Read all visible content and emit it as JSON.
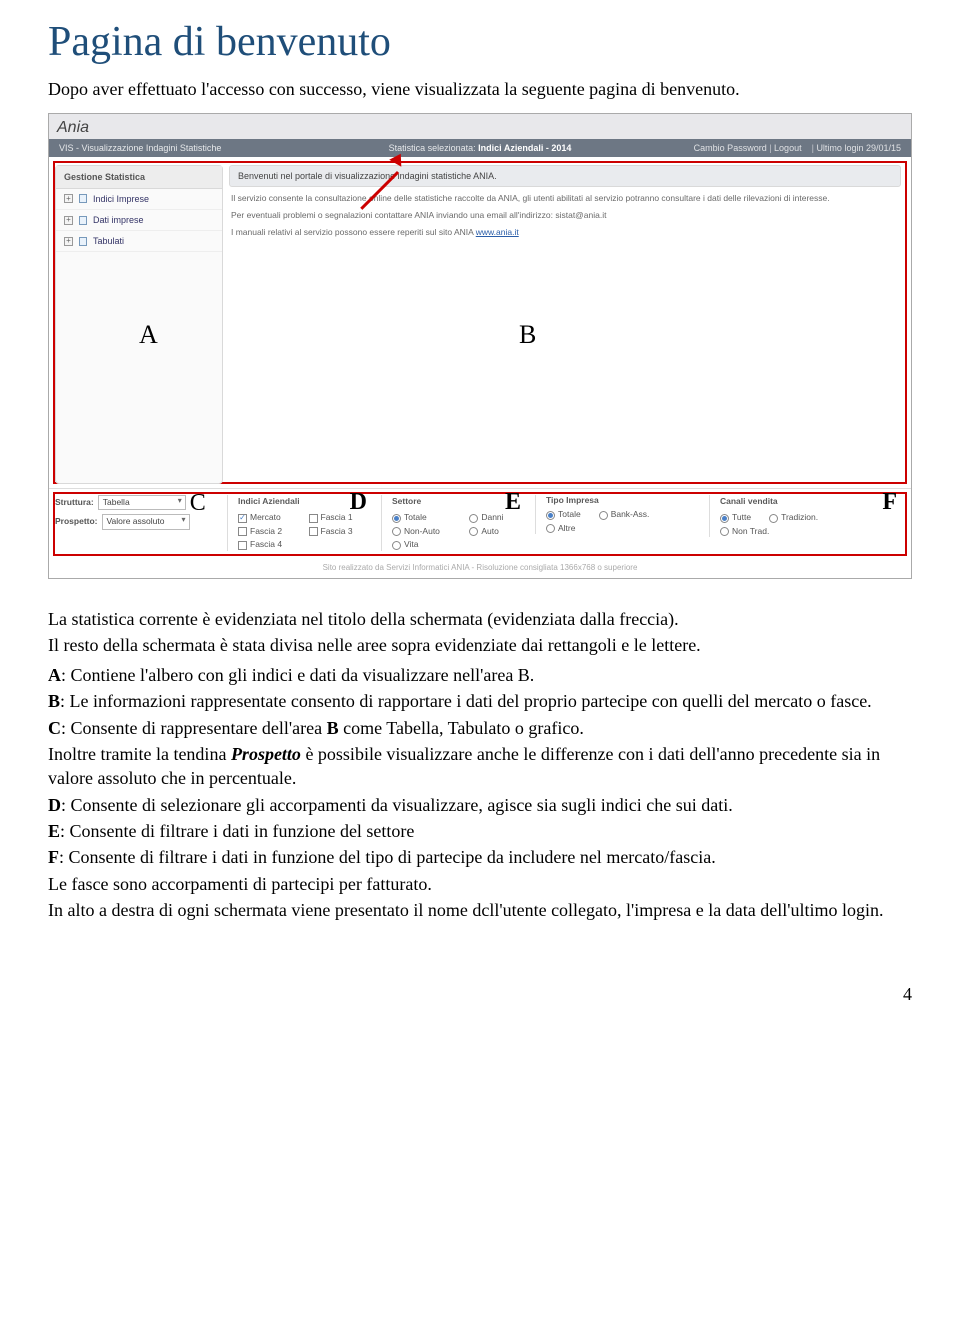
{
  "page": {
    "title": "Pagina di benvenuto",
    "intro": "Dopo aver effettuato l'accesso con successo, viene visualizzata la seguente pagina di benvenuto.",
    "number": "4"
  },
  "labels": {
    "A": "A",
    "B": "B",
    "C": "C",
    "D": "D",
    "E": "E",
    "F": "F"
  },
  "screenshot": {
    "brand": "Ania",
    "subtitle": "VIS - Visualizzazione Indagini Statistiche",
    "centerPrefix": "Statistica selezionata: ",
    "centerBold": "Indici Aziendali - 2014",
    "lastLogin": "Ultimo login 29/01/15",
    "rightLinks": {
      "a": "Cambio Password",
      "b": "Logout"
    },
    "sidebar": {
      "title": "Gestione Statistica",
      "items": [
        "Indici Imprese",
        "Dati imprese",
        "Tabulati"
      ]
    },
    "main": {
      "welcome": "Benvenuti nel portale di visualizzazione indagini statistiche ANIA.",
      "p1": "Il servizio consente la consultazione online delle statistiche raccolte da ANIA, gli utenti abilitati al servizio potranno consultare i dati delle rilevazioni di interesse.",
      "p2a": "Per eventuali problemi o segnalazioni contattare ANIA inviando una email all'indirizzo: ",
      "p2mail": "sistat@ania.it",
      "p3a": "I manuali relativi al servizio possono essere reperiti sul sito ANIA ",
      "p3link": "www.ania.it"
    },
    "bottom": {
      "struttura": {
        "label": "Struttura:",
        "value": "Tabella"
      },
      "prospetto": {
        "label": "Prospetto:",
        "value": "Valore assoluto"
      },
      "indici": {
        "title": "Indici Aziendali",
        "opts": [
          "Mercato",
          "Fascia 1",
          "Fascia 2",
          "Fascia 3",
          "Fascia 4"
        ]
      },
      "settore": {
        "title": "Settore",
        "opts": [
          "Totale",
          "Danni",
          "Non-Auto",
          "Auto",
          "Vita"
        ]
      },
      "tipo": {
        "title": "Tipo Impresa",
        "opts": [
          "Totale",
          "Bank-Ass.",
          "Altre"
        ]
      },
      "canali": {
        "title": "Canali vendita",
        "opts": [
          "Tutte",
          "Tradizion.",
          "Non Trad."
        ]
      }
    },
    "footnote": "Sito realizzato da Servizi Informatici ANIA - Risoluzione consigliata 1366x768 o superiore"
  },
  "body": {
    "p1": "La statistica corrente è evidenziata nel titolo della schermata (evidenziata dalla freccia).",
    "p2": "Il resto della schermata è stata divisa nelle aree sopra evidenziate dai rettangoli e le lettere.",
    "A": "A: Contiene l'albero con gli indici e dati da visualizzare nell'area B.",
    "B": "B: Le informazioni rappresentate consento di rapportare i dati del proprio partecipe con quelli del mercato o fasce.",
    "C": "C: Consente di rappresentare dell'area B come Tabella, Tabulato o grafico.",
    "Csub": "Inoltre tramite la tendina Prospetto è possibile visualizzare anche le differenze con i dati dell'anno precedente sia in valore assoluto che in percentuale.",
    "D": "D: Consente di selezionare gli accorpamenti da visualizzare, agisce sia sugli indici che sui dati.",
    "E": "E: Consente di filtrare i dati in funzione del settore",
    "F": "F: Consente di filtrare i dati in funzione del tipo di partecipe da includere nel mercato/fascia.",
    "Fsub": "Le fasce sono accorpamenti di partecipi per fatturato.",
    "closing": "In alto a destra di ogni schermata viene presentato il nome dcll'utente collegato, l'impresa e la data dell'ultimo login."
  }
}
